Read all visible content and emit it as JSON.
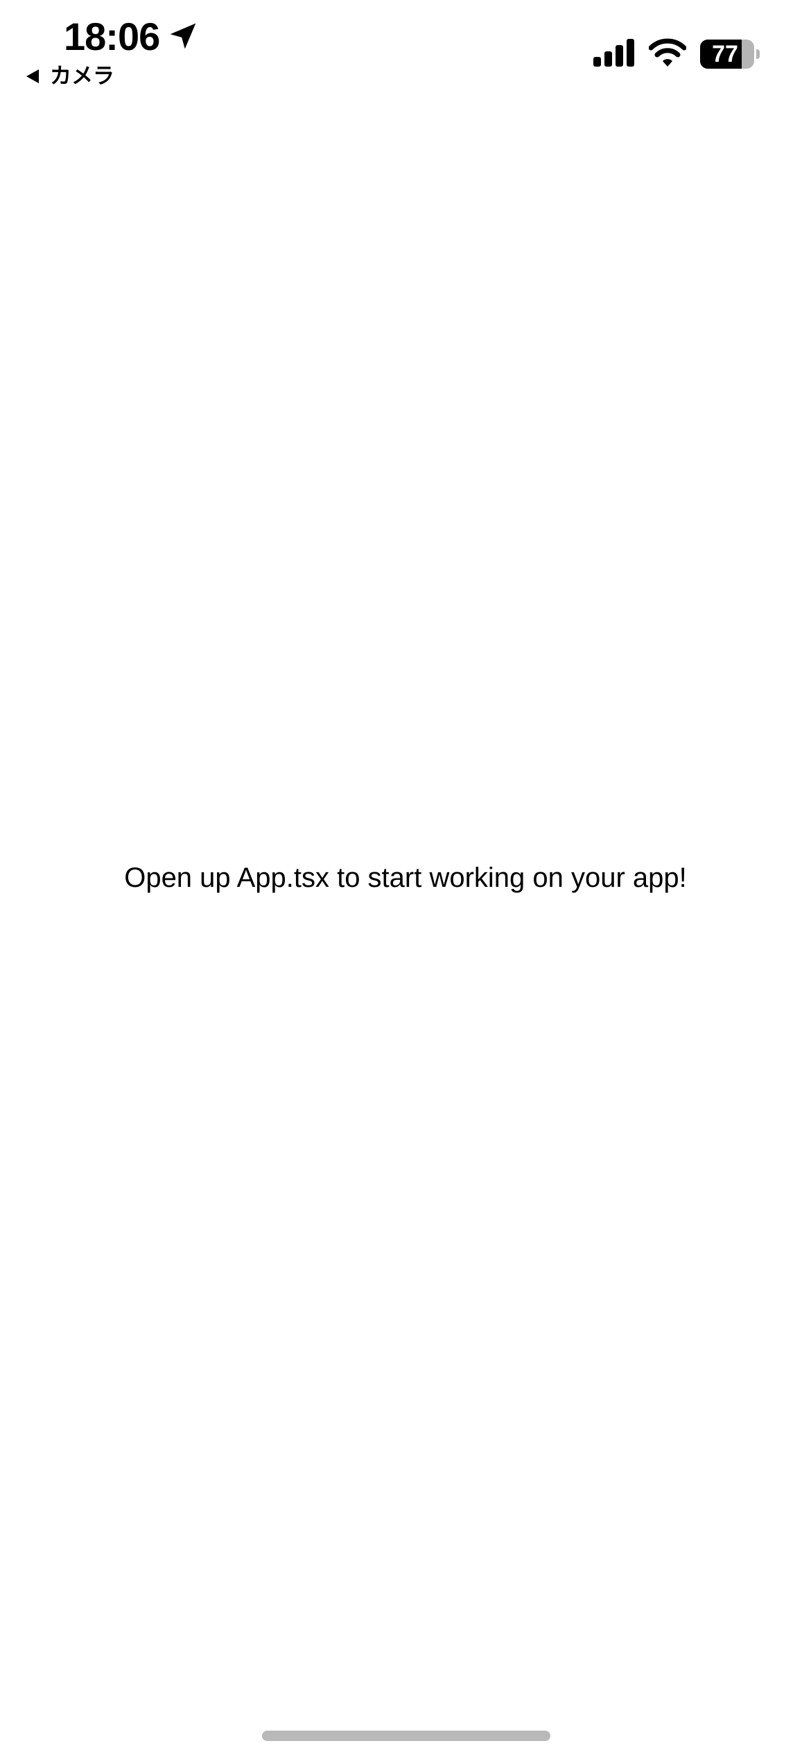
{
  "status_bar": {
    "time": "18:06",
    "back_label": "カメラ",
    "battery_level": "77",
    "battery_fraction": 0.77
  },
  "icons": {
    "location": "location-arrow-icon",
    "back": "back-triangle-icon",
    "signal": "cellular-signal-icon",
    "wifi": "wifi-icon",
    "battery": "battery-icon"
  },
  "main": {
    "message": "Open up App.tsx to start working on your app!"
  },
  "colors": {
    "background": "#ffffff",
    "text": "#000000",
    "battery_empty": "#b5b5b5",
    "home_indicator": "#b9b9b9"
  }
}
